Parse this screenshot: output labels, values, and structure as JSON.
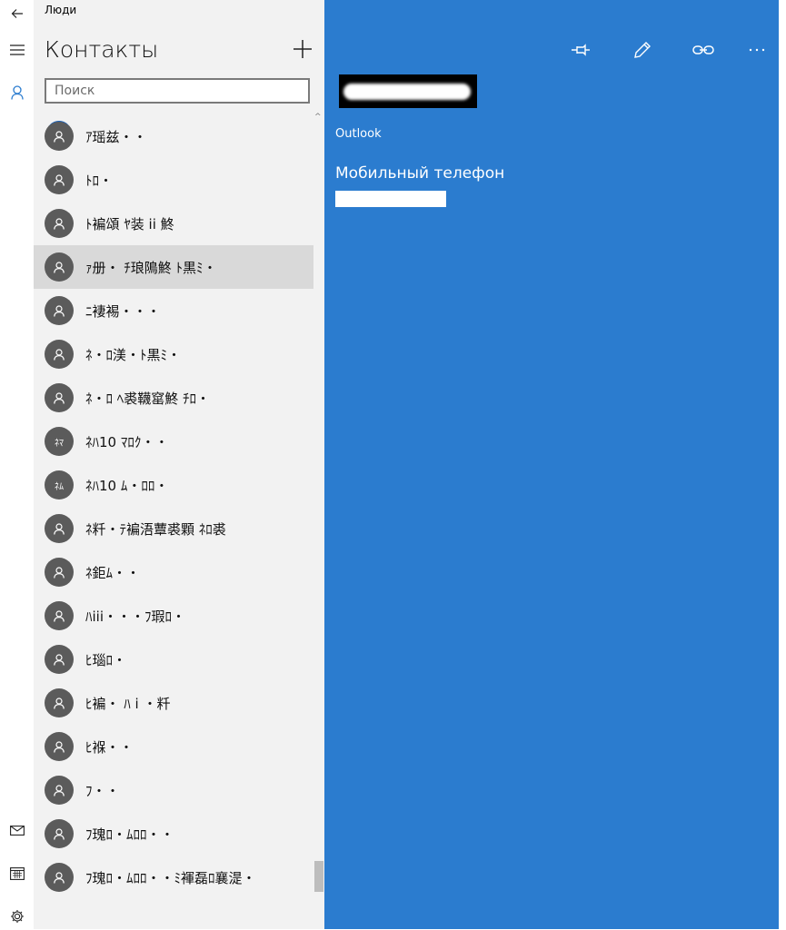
{
  "app": {
    "title": "Люди"
  },
  "header": {
    "title": "Контакты"
  },
  "search": {
    "placeholder": "Поиск"
  },
  "contacts": [
    {
      "name": "ｱ瑶兹・・",
      "initials": ""
    },
    {
      "name": "ﾄﾛ・",
      "initials": ""
    },
    {
      "name": "ﾄ褊頌 ﾔ装 ii 鮗",
      "initials": ""
    },
    {
      "name": "ｧ册・ ﾁ琅隝鮗 ﾄ黒ﾐ・",
      "initials": "",
      "selected": true
    },
    {
      "name": "ﾆ褄裼・・・",
      "initials": ""
    },
    {
      "name": "ﾈ・ﾛ渼・ﾄ黒ﾐ・",
      "initials": ""
    },
    {
      "name": "ﾈ・ﾛ ﾍ裘韈窰鮗 ﾁﾛ・",
      "initials": ""
    },
    {
      "name": "ﾈﾊ10 ﾏﾛｸ・・",
      "initials": "ﾈﾏ"
    },
    {
      "name": "ﾈﾊ10 ﾑ・ﾛﾛ・",
      "initials": "ﾈﾑ"
    },
    {
      "name": "ﾈ粁・ﾃ褊浯蕈裘顆 ﾈﾛ裘",
      "initials": ""
    },
    {
      "name": "ﾈ鉅ﾑ・・",
      "initials": ""
    },
    {
      "name": "ﾊiii・・・ﾌ瑕ﾛ・",
      "initials": ""
    },
    {
      "name": "ﾋ瑙ﾛ・",
      "initials": ""
    },
    {
      "name": "ﾋ褊・ ﾊ i ・粁",
      "initials": ""
    },
    {
      "name": "ﾋ褓・・",
      "initials": ""
    },
    {
      "name": "ﾌ・・",
      "initials": ""
    },
    {
      "name": "ﾌ瑰ﾛ・ﾑﾛﾛ・・",
      "initials": ""
    },
    {
      "name": "ﾌ瑰ﾛ・ﾑﾛﾛ・・ﾐ褌磊ﾛ襄湜・",
      "initials": ""
    }
  ],
  "detail": {
    "source": "Outlook",
    "phone_label": "Мобильный телефон"
  },
  "icons": {
    "back": "back-arrow-icon",
    "menu": "hamburger-icon",
    "contacts": "person-icon",
    "mail": "mail-icon",
    "calendar": "calendar-icon",
    "settings": "gear-icon",
    "pin": "pin-icon",
    "edit": "pencil-icon",
    "link": "link-icon",
    "more": "more-icon"
  },
  "colors": {
    "accent": "#2b7ccf",
    "pane": "#f2f2f2",
    "avatar": "#5b5b5b",
    "selected": "#d9d9d9"
  }
}
